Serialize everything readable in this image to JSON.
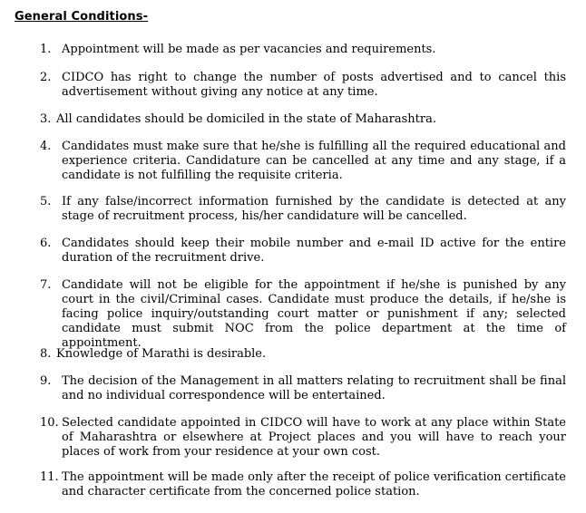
{
  "heading": "General Conditions-",
  "conditions": [
    {
      "num": "1.",
      "text": "Appointment will be made as per vacancies and requirements."
    },
    {
      "num": "2.",
      "text": "CIDCO has right to change the number of posts advertised and to cancel this advertisement without giving any notice at any time."
    },
    {
      "num": "3.",
      "text": "All candidates should be domiciled in the state of Maharashtra."
    },
    {
      "num": "4.",
      "text": "Candidates must make sure that he/she is fulfilling all the required educational and experience criteria. Candidature can be cancelled at any time and any stage, if a candidate is not fulfilling the requisite criteria."
    },
    {
      "num": "5.",
      "text": "If any false/incorrect information furnished by the candidate is detected at any stage of recruitment process, his/her candidature will be cancelled."
    },
    {
      "num": "6.",
      "text": "Candidates should keep their mobile number and e-mail ID active for the entire duration of the recruitment drive."
    },
    {
      "num": "7.",
      "text": "Candidate will not be eligible for the appointment if he/she is punished by any court in the civil/Criminal cases. Candidate must produce the details, if he/she is facing police inquiry/outstanding court matter or punishment if any; selected candidate must submit NOC from the police department at the time of appointment."
    },
    {
      "num": "8.",
      "text": "Knowledge of Marathi is desirable."
    },
    {
      "num": "9.",
      "text": "The decision of the Management in all matters relating to recruitment shall be final and no individual correspondence will be entertained."
    },
    {
      "num": "10.",
      "text": "Selected candidate appointed in CIDCO will have to work at any place within State of Maharashtra or elsewhere at Project places and you will have to reach your places of work from your residence at your own cost."
    },
    {
      "num": "11.",
      "text": "The appointment will be made only after the receipt of police verification certificate and character certificate from the concerned police station."
    }
  ]
}
